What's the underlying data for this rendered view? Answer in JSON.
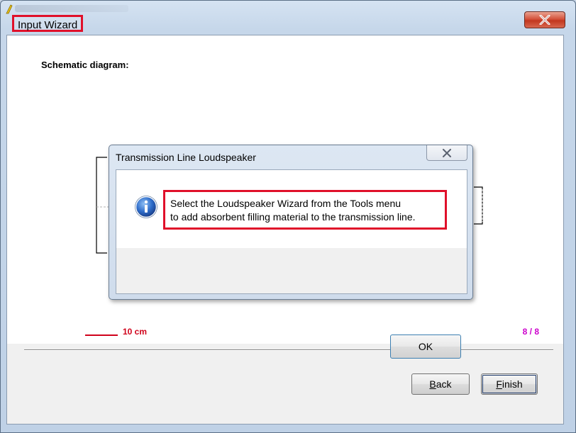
{
  "window": {
    "title": "Input Wizard"
  },
  "content": {
    "schematic_label": "Schematic diagram:",
    "scale_label": "10 cm",
    "page_counter": "8 / 8"
  },
  "buttons": {
    "back": {
      "prefix": "",
      "accel": "B",
      "rest": "ack"
    },
    "finish": {
      "prefix": "",
      "accel": "F",
      "rest": "inish"
    }
  },
  "dialog": {
    "title": "Transmission Line Loudspeaker",
    "message_line1": "Select the Loudspeaker Wizard from the Tools menu",
    "message_line2": "to add absorbent filling material to the transmission line.",
    "ok_label": "OK"
  },
  "colors": {
    "highlight": "#e0102a",
    "scale": "#d0021b",
    "counter": "#cc00cc"
  },
  "icons": {
    "app": "app-icon",
    "close": "close-icon",
    "info": "info-icon"
  }
}
